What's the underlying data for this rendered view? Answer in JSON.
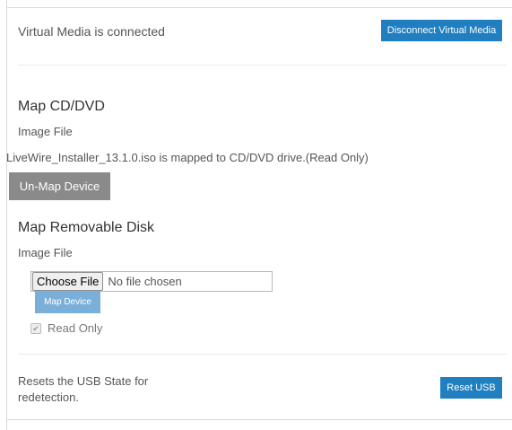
{
  "status": {
    "text": "Virtual Media is connected",
    "disconnect_label": "Disconnect Virtual Media"
  },
  "cd_dvd": {
    "title": "Map CD/DVD",
    "image_label": "Image File",
    "mapped_text": "LiveWire_Installer_13.1.0.iso is mapped to CD/DVD drive.(Read Only)",
    "unmap_label": "Un-Map Device"
  },
  "removable_disk": {
    "title": "Map Removable Disk",
    "image_label": "Image File",
    "choose_file_label": "Choose File",
    "no_file_text": "No file chosen",
    "map_label": "Map Device",
    "read_only_label": "Read Only",
    "read_only_checked": true
  },
  "usb": {
    "reset_text": "Resets the USB State for redetection.",
    "reset_label": "Reset USB"
  },
  "colors": {
    "primary_button": "#1f7fc1",
    "disabled_button": "#7aafda",
    "gray_button": "#8a8a8a"
  }
}
